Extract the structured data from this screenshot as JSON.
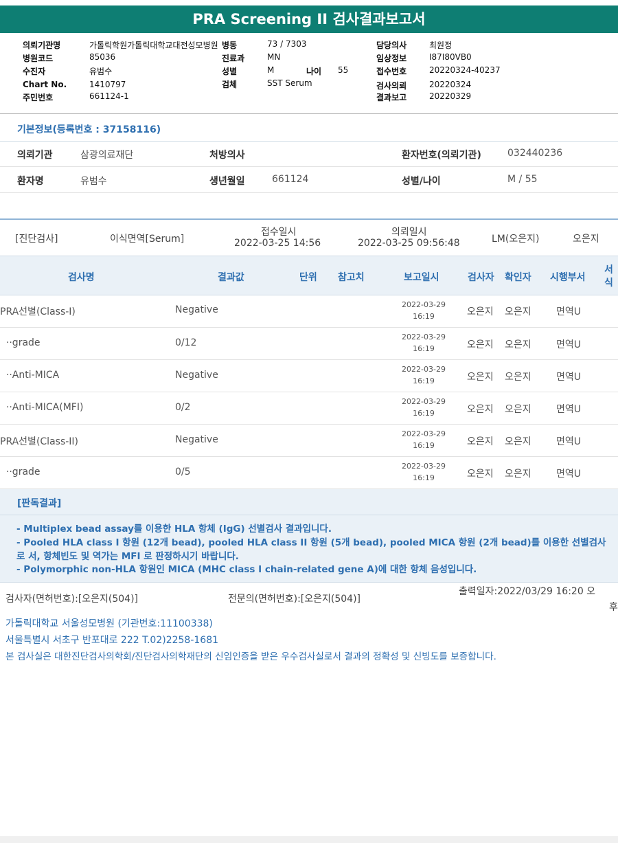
{
  "title": "PRA Screening II 검사결과보고서",
  "header": {
    "c1": [
      {
        "label": "의뢰기관명",
        "value": "가톨릭학원가톨릭대학교대전성모병원"
      },
      {
        "label": "병원코드",
        "value": "85036"
      },
      {
        "label": "수진자",
        "value": "유범수"
      },
      {
        "label": "Chart No.",
        "value": "1410797"
      },
      {
        "label": "주민번호",
        "value": "661124-1"
      }
    ],
    "c2": [
      {
        "label": "병동",
        "value": "73 / 7303"
      },
      {
        "label": "진료과",
        "value": "MN"
      },
      {
        "label": "성별",
        "value": "M"
      },
      {
        "label": "검체",
        "value": "SST Serum"
      }
    ],
    "age_label": "나이",
    "age_value": "55",
    "c3": [
      {
        "label": "담당의사",
        "value": "최원정"
      },
      {
        "label": "임상정보",
        "value": "I87I80VB0"
      },
      {
        "label": "접수번호",
        "value": "20220324-40237"
      },
      {
        "label": "검사의뢰",
        "value": "20220324"
      },
      {
        "label": "결과보고",
        "value": "20220329"
      }
    ]
  },
  "basic": {
    "title": "기본정보(등록번호 : 37158116)",
    "row1": {
      "k1": "의뢰기관",
      "v1": "삼광의료재단",
      "k2": "처방의사",
      "v2": "",
      "k3": "환자번호(의뢰기관)",
      "v3": "032440236"
    },
    "row2": {
      "k1": "환자명",
      "v1": "유범수",
      "k2": "생년월일",
      "v2": "661124",
      "k3": "성별/나이",
      "v3": "M / 55"
    }
  },
  "diag": {
    "type": "[진단검사]",
    "specimen": "이식면역[Serum]",
    "recv_label": "접수일시",
    "recv_value": "2022-03-25  14:56",
    "req_label": "의뢰일시",
    "req_value": "2022-03-25  09:56:48",
    "lm": "LM(오은지)",
    "person": "오은지"
  },
  "table": {
    "headers": {
      "name": "검사명",
      "result": "결과값",
      "unit": "단위",
      "ref": "참고치",
      "report": "보고일시",
      "tester": "검사자",
      "confirmer": "확인자",
      "dept": "시행부서",
      "form1": "서",
      "form2": "식"
    },
    "rows": [
      {
        "name": "PRA선별(Class-I)",
        "result": "Negative",
        "date": "2022-03-29",
        "time": "16:19",
        "tester": "오은지",
        "confirmer": "오은지",
        "dept": "면역U"
      },
      {
        "name": "  ··grade",
        "result": "0/12",
        "date": "2022-03-29",
        "time": "16:19",
        "tester": "오은지",
        "confirmer": "오은지",
        "dept": "면역U"
      },
      {
        "name": "  ··Anti-MICA",
        "result": "Negative",
        "date": "2022-03-29",
        "time": "16:19",
        "tester": "오은지",
        "confirmer": "오은지",
        "dept": "면역U"
      },
      {
        "name": "  ··Anti-MICA(MFI)",
        "result": "0/2",
        "date": "2022-03-29",
        "time": "16:19",
        "tester": "오은지",
        "confirmer": "오은지",
        "dept": "면역U"
      },
      {
        "name": "PRA선별(Class-II)",
        "result": "Negative",
        "date": "2022-03-29",
        "time": "16:19",
        "tester": "오은지",
        "confirmer": "오은지",
        "dept": "면역U"
      },
      {
        "name": "  ··grade",
        "result": "0/5",
        "date": "2022-03-29",
        "time": "16:19",
        "tester": "오은지",
        "confirmer": "오은지",
        "dept": "면역U"
      }
    ]
  },
  "judgment": {
    "title": "[판독결과]",
    "lines": [
      "- Multiplex bead assay를 이용한 HLA 항체 (IgG) 선별검사 결과입니다.",
      "- Pooled HLA class I 항원 (12개 bead), pooled HLA class II 항원 (5개 bead), pooled MICA 항원 (2개 bead)를 이용한 선별검사로 서, 항체빈도 및 역가는 MFI 로 판정하시기 바랍니다.",
      "- Polymorphic non-HLA 항원인 MICA (MHC class I chain-related gene A)에 대한 항체 음성입니다."
    ]
  },
  "footer": {
    "tester": "검사자(면허번호):[오은지(504)]",
    "specialist": "전문의(면허번호):[오은지(504)]",
    "print_date": "출력일자:2022/03/29 16:20 오",
    "print_date_tail": "후",
    "hospital": "가톨릭대학교 서울성모병원 (기관번호:11100338)",
    "address": "서울특별시 서초구 반포대로 222 T.02)2258-1681",
    "certification": "본 검사실은 대한진단검사의학회/진단검사의학재단의 신임인증을 받은 우수검사실로서 결과의 정확성 및 신빙도를 보증합니다."
  }
}
